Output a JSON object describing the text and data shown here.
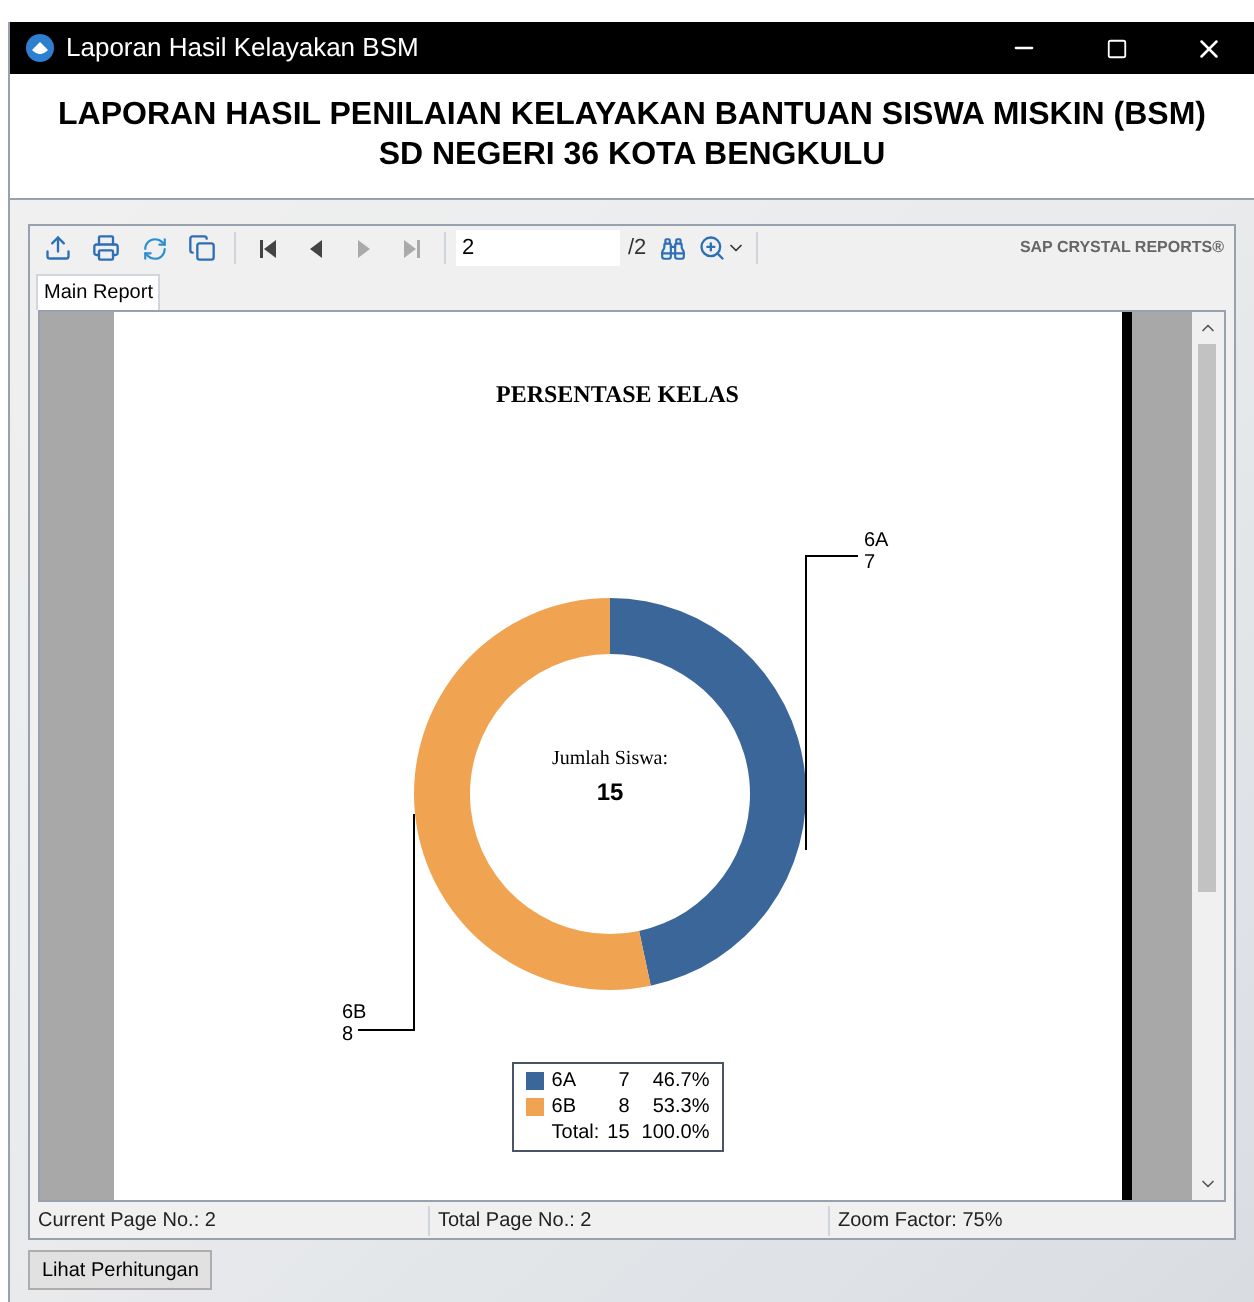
{
  "window": {
    "title": "Laporan Hasil Kelayakan BSM"
  },
  "header": {
    "line_1": "LAPORAN HASIL PENILAIAN KELAYAKAN BANTUAN SISWA MISKIN (BSM)",
    "line_2": "SD NEGERI 36 KOTA BENGKULU"
  },
  "toolbar": {
    "page_field": "2",
    "page_total": "/2",
    "brand": "SAP CRYSTAL REPORTS®"
  },
  "tabs": [
    {
      "label": "Main Report",
      "selected": true
    }
  ],
  "report": {
    "chart_data": {
      "type": "donut",
      "title": "PERSENTASE KELAS",
      "categories": [
        "6A",
        "6B"
      ],
      "values": [
        7,
        8
      ],
      "data_labels": true
    },
    "center_label": "Jumlah Siswa:",
    "center_value": "15",
    "legend": [
      {
        "label": "6A",
        "count": "7",
        "percent": "46.7%",
        "color": "#3a6699"
      },
      {
        "label": "6B",
        "count": "8",
        "percent": "53.3%",
        "color": "#f0a452"
      }
    ],
    "legend_total": {
      "label": "Total:",
      "count": "15",
      "percent": "100.0%"
    }
  },
  "status_bar": [
    "Current Page No.: 2",
    "Total Page No.: 2",
    "Zoom Factor: 75%"
  ],
  "button": "Lihat Perhitungan"
}
